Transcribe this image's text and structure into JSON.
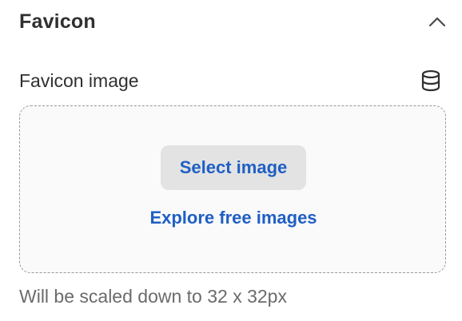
{
  "section": {
    "title": "Favicon",
    "collapse_icon": "chevron-up-icon"
  },
  "field": {
    "label": "Favicon image",
    "action_icon": "database-icon"
  },
  "dropzone": {
    "select_button_label": "Select image",
    "explore_link_label": "Explore free images"
  },
  "help_text": "Will be scaled down to 32 x 32px",
  "colors": {
    "link": "#1f5fc4",
    "button_bg": "#e3e3e3",
    "dropzone_bg": "#fafafa",
    "dropzone_border": "#9a9a9a",
    "title_text": "#303030",
    "help_text": "#6b6b6b"
  }
}
